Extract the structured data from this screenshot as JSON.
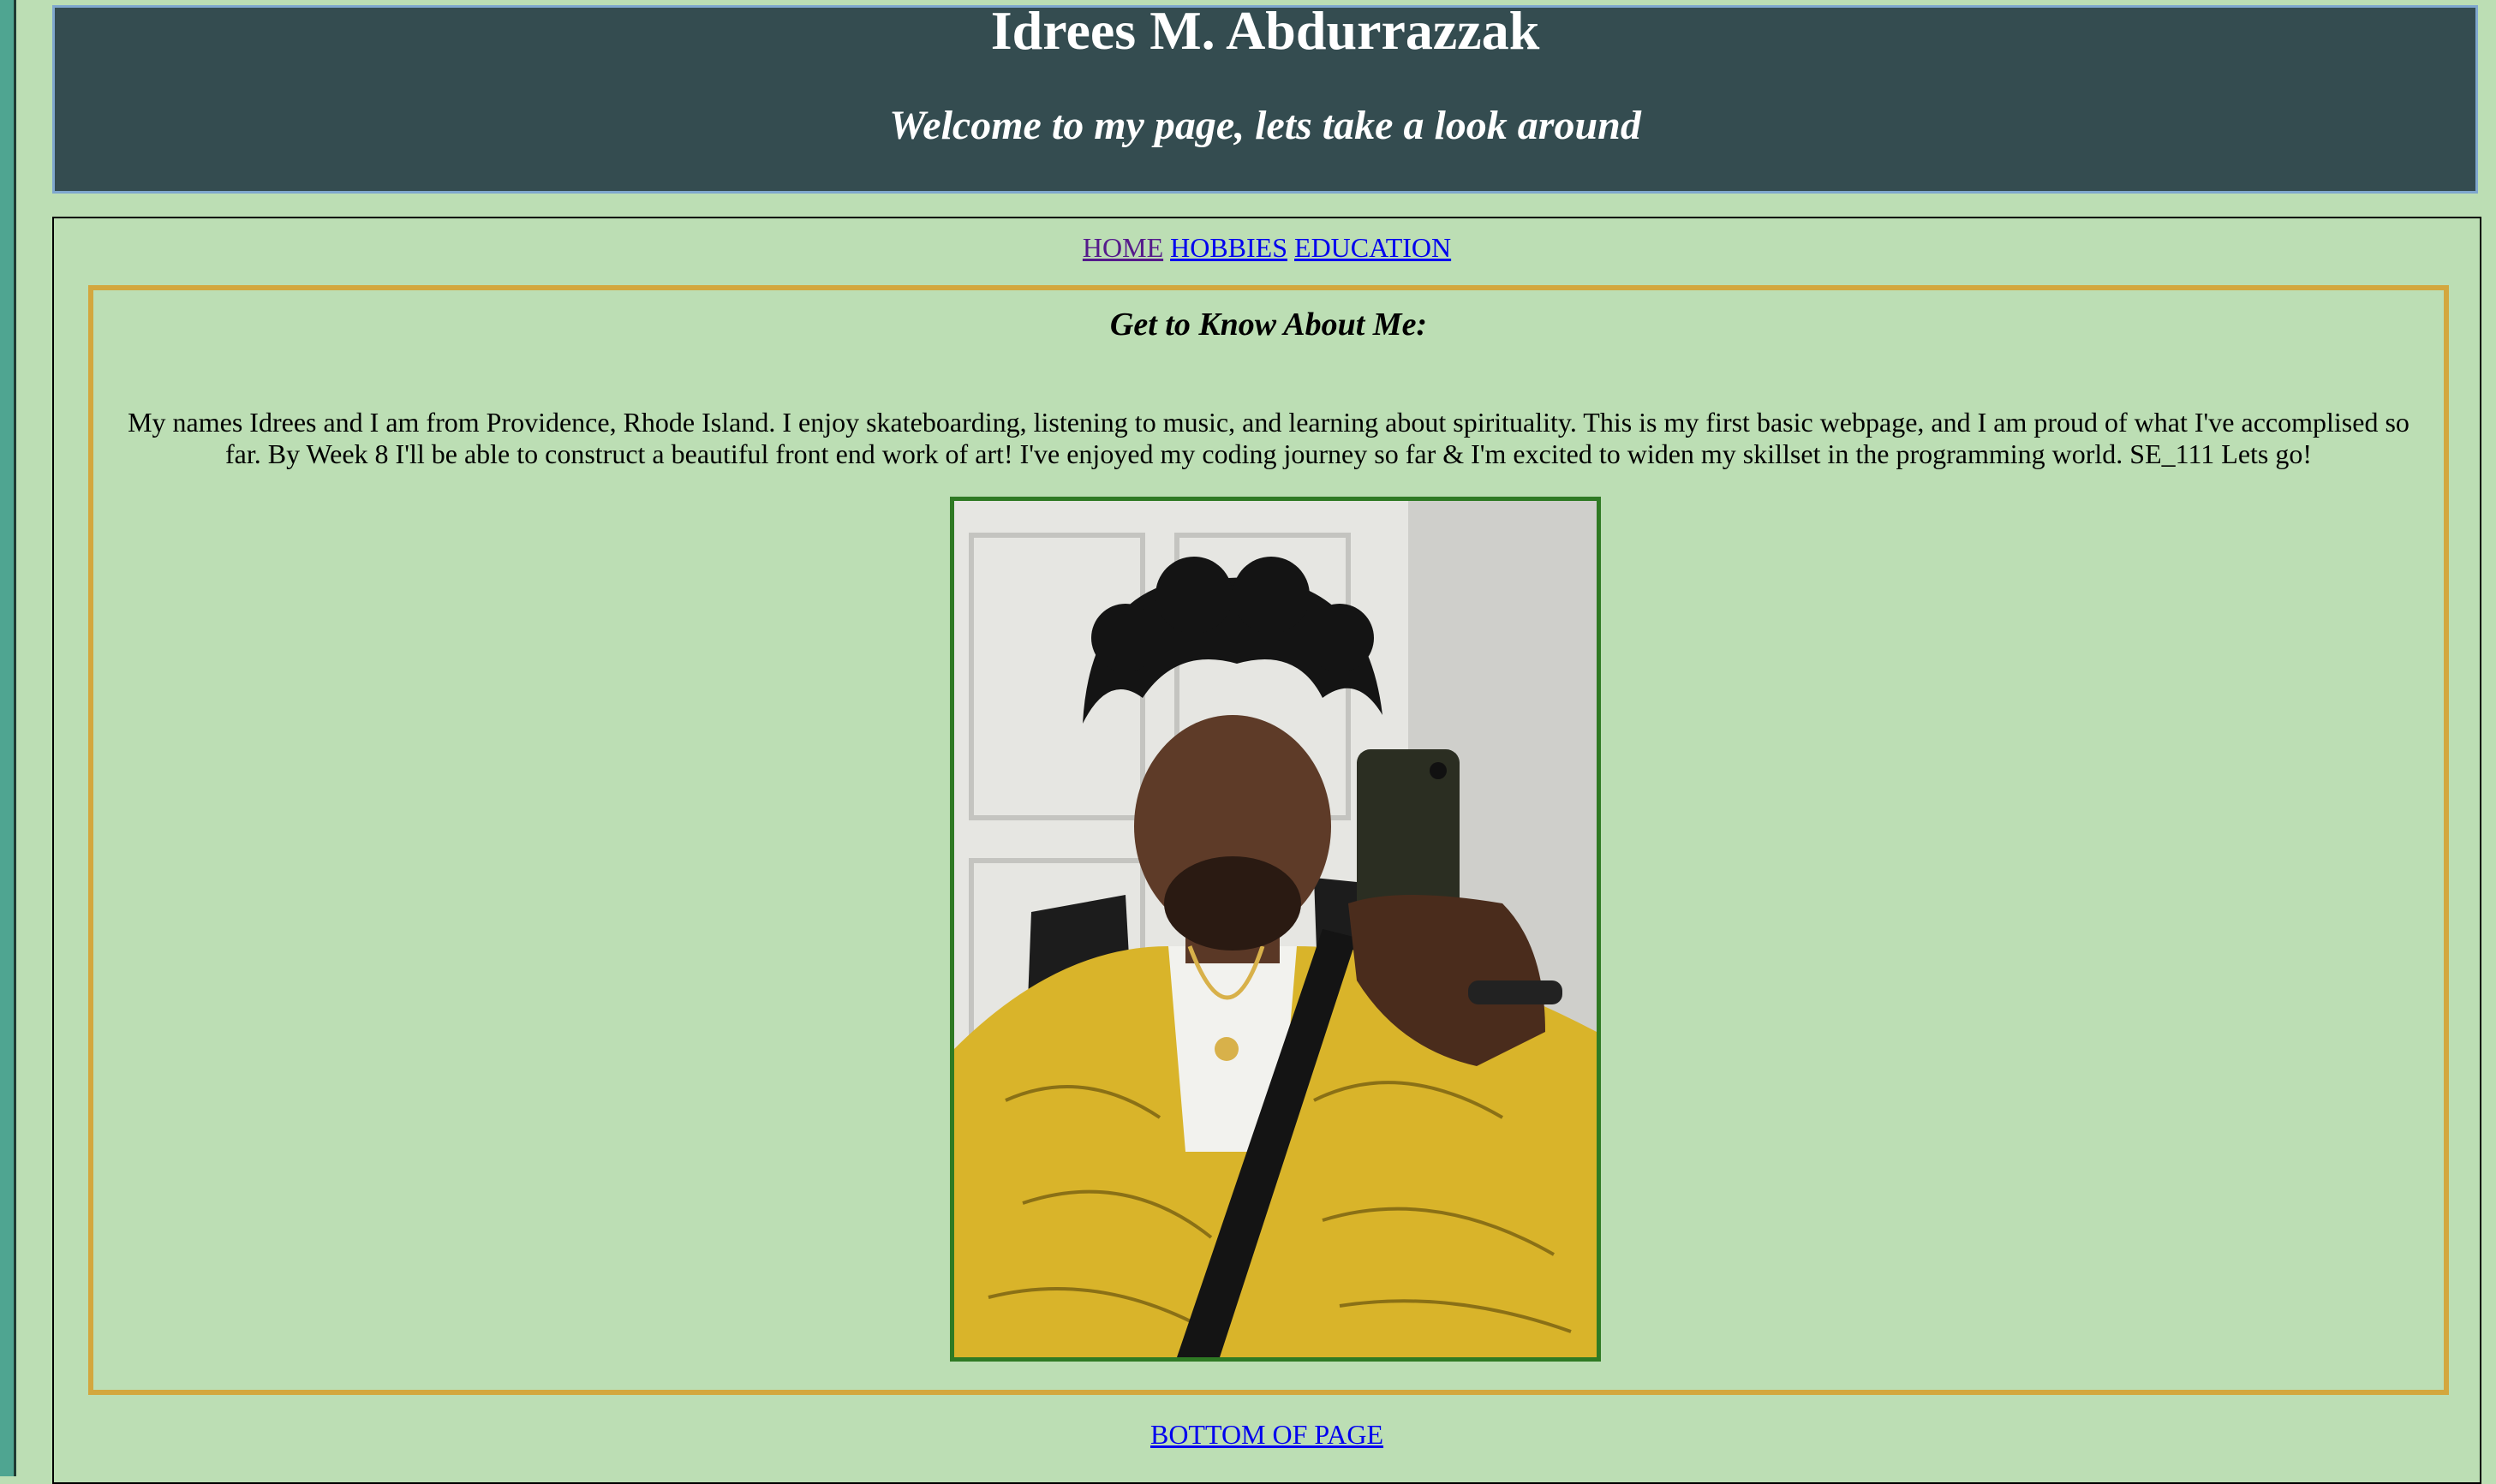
{
  "header": {
    "name": "Idrees M. Abdurrazzak",
    "tagline": "Welcome to my page, lets take a look around"
  },
  "nav": {
    "items": [
      {
        "label": "HOME"
      },
      {
        "label": "HOBBIES"
      },
      {
        "label": "EDUCATION"
      }
    ]
  },
  "about": {
    "heading": "Get to Know About Me:",
    "body": "My names Idrees and I am from Providence, Rhode Island. I enjoy skateboarding, listening to music, and learning about spirituality. This is my first basic webpage, and I am proud of what I've accomplised so far. By Week 8 I'll be able to construct a beautiful front end work of art! I've enjoyed my coding journey so far & I'm excited to widen my skillset in the programming world. SE_111 Lets go!"
  },
  "footer": {
    "bottom_link": "BOTTOM OF PAGE"
  },
  "colors": {
    "page_bg": "#bcdeb4",
    "header_bg": "#344c50",
    "about_border": "#d3a73e",
    "photo_border": "#2f7a24",
    "link": "#0000ee",
    "visited_link": "#551a8b"
  }
}
